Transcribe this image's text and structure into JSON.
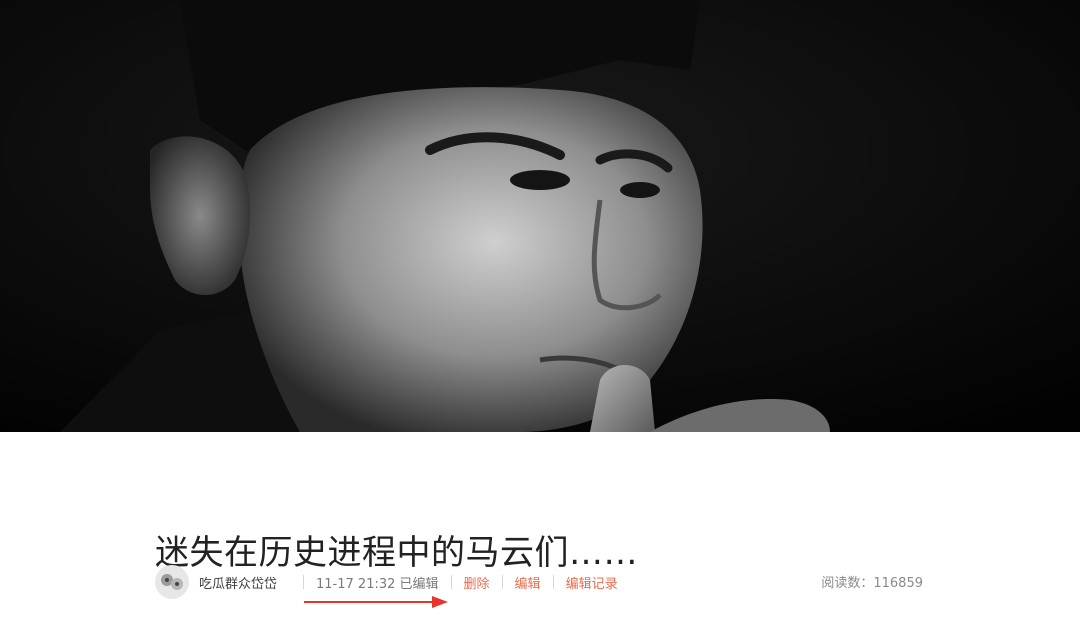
{
  "hero_image": {
    "description_icon": "portrait-photo"
  },
  "article": {
    "title": "迷失在历史进程中的马云们……"
  },
  "meta": {
    "author": "吃瓜群众岱岱",
    "datetime": "11-17 21:32 已编辑",
    "actions": {
      "delete": "删除",
      "edit": "编辑",
      "history": "编辑记录"
    },
    "reads_label": "阅读数：",
    "reads_count": "116859"
  },
  "colors": {
    "accent": "#ea6c4f",
    "arrow": "#e8352b",
    "title": "#222222"
  }
}
